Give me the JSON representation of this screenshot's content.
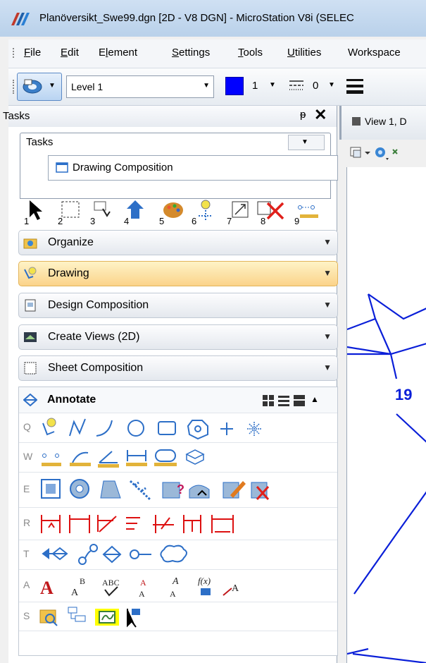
{
  "window": {
    "title": "Planöversikt_Swe99.dgn [2D - V8 DGN] - MicroStation V8i (SELEC"
  },
  "menu": {
    "items": [
      {
        "label": "File",
        "u": "F",
        "rest": "ile"
      },
      {
        "label": "Edit",
        "u": "E",
        "rest": "dit"
      },
      {
        "label": "Element",
        "u": "l",
        "pre": "E",
        "rest": "ement"
      },
      {
        "label": "Settings",
        "u": "S",
        "rest": "ettings"
      },
      {
        "label": "Tools",
        "u": "T",
        "rest": "ools"
      },
      {
        "label": "Utilities",
        "u": "U",
        "rest": "tilities"
      },
      {
        "label": "Workspace",
        "u": "",
        "rest": "Workspace"
      }
    ]
  },
  "toolbar": {
    "level_value": "Level 1",
    "color_value": "1",
    "color_hex": "#0000ff",
    "style_value": "0"
  },
  "tasks_panel": {
    "title": "Tasks",
    "dropdown_value": "Tasks",
    "current_task": "Drawing Composition",
    "tool_numbers": [
      "1",
      "2",
      "3",
      "4",
      "5",
      "6",
      "7",
      "8",
      "9"
    ],
    "groups": [
      {
        "label": "Organize",
        "active": false
      },
      {
        "label": "Drawing",
        "active": true
      },
      {
        "label": "Design Composition",
        "active": false
      },
      {
        "label": "Create Views (2D)",
        "active": false
      },
      {
        "label": "Sheet Composition",
        "active": false
      }
    ],
    "annotate": {
      "label": "Annotate",
      "row_keys": [
        "Q",
        "W",
        "E",
        "R",
        "T",
        "A",
        "S"
      ]
    }
  },
  "view": {
    "tab_label": "View 1, D",
    "drawing_label": "19",
    "line_color": "#0a1fd8"
  },
  "colors": {
    "active_group_top": "#fef3c7",
    "active_group_bottom": "#fbd38a",
    "highlight_tool": "#ffff00"
  }
}
